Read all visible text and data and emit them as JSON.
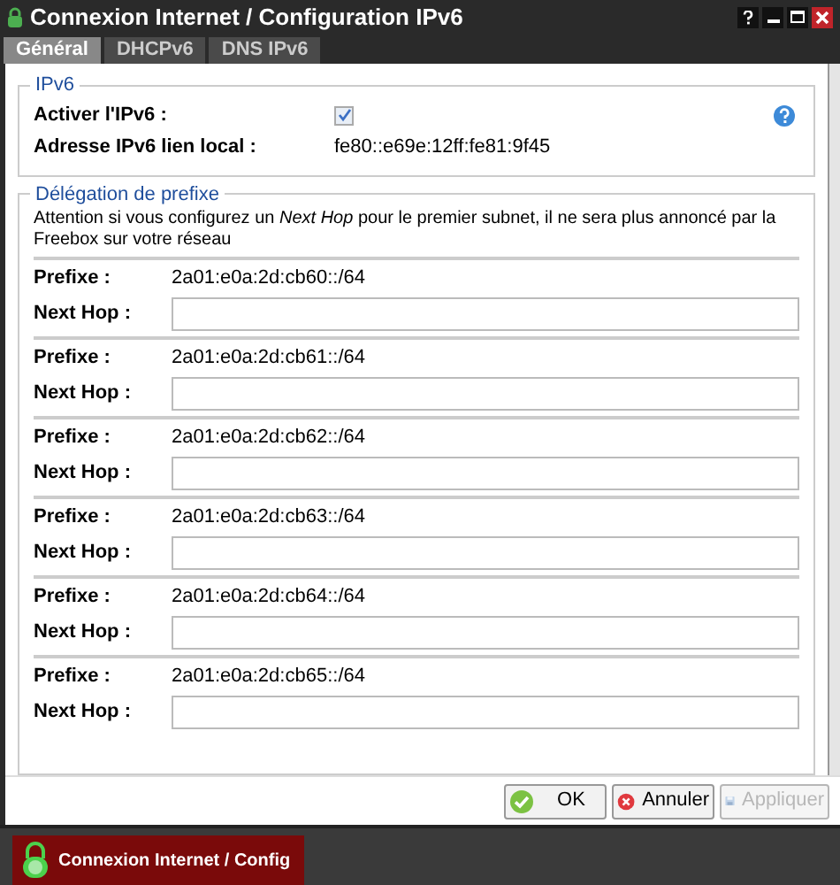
{
  "window": {
    "title": "Connexion Internet / Configuration IPv6"
  },
  "tabs": [
    {
      "label": "Général",
      "selected": true
    },
    {
      "label": "DHCPv6",
      "selected": false
    },
    {
      "label": "DNS IPv6",
      "selected": false
    }
  ],
  "ipv6": {
    "legend": "IPv6",
    "enable_label": "Activer l'IPv6 :",
    "enabled": true,
    "address_label": "Adresse IPv6 lien local :",
    "address": "fe80::e69e:12ff:fe81:9f45"
  },
  "delegation": {
    "legend": "Délégation de prefixe",
    "note": "Attention si vous configurez un *Next Hop* pour le premier subnet, il ne sera plus annoncé par la Freebox sur votre réseau",
    "rows": [
      {
        "prefix_label": "Prefixe :",
        "prefix": "2a01:e0a:2d:cb60::/64",
        "hop_label": "Next Hop :"
      },
      {
        "prefix_label": "Prefixe :",
        "prefix": "2a01:e0a:2d:cb61::/64",
        "hop_label": "Next Hop :"
      },
      {
        "prefix_label": "Prefixe :",
        "prefix": "2a01:e0a:2d:cb62::/64",
        "hop_label": "Next Hop :"
      },
      {
        "prefix_label": "Prefixe :",
        "prefix": "2a01:e0a:2d:cb63::/64",
        "hop_label": "Next Hop :"
      },
      {
        "prefix_label": "Prefixe :",
        "prefix": "2a01:e0a:2d:cb64::/64",
        "hop_label": "Next Hop :"
      },
      {
        "prefix_label": "Prefixe :",
        "prefix": "2a01:e0a:2d:cb65::/64",
        "hop_label": "Next Hop :"
      }
    ]
  },
  "buttons": [
    {
      "kind": "ok",
      "label": "OK",
      "disabled": false
    },
    {
      "kind": "cancel",
      "label": "Annuler",
      "disabled": false
    },
    {
      "kind": "apply",
      "label": "Appliquer",
      "disabled": true
    }
  ],
  "taskbar": {
    "label": "Connexion Internet / Config"
  }
}
